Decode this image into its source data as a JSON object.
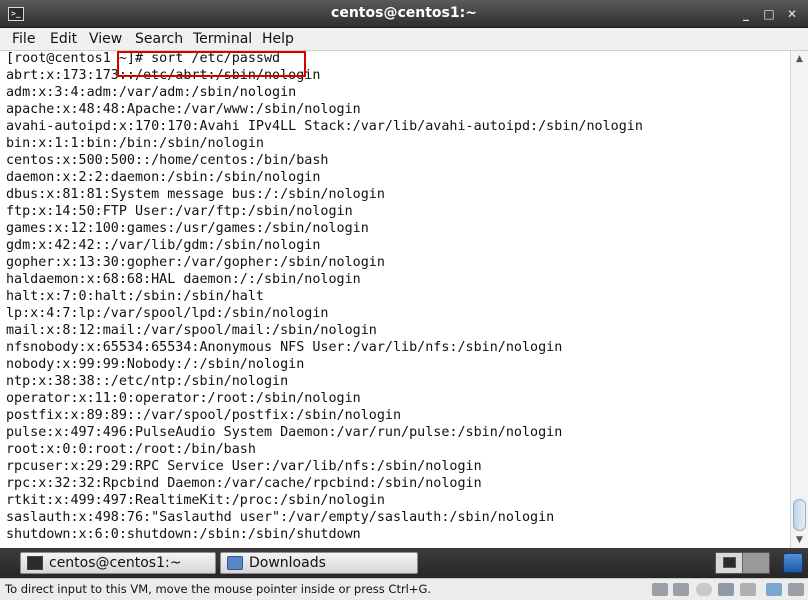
{
  "window": {
    "title": "centos@centos1:~"
  },
  "menu": [
    "File",
    "Edit",
    "View",
    "Search",
    "Terminal",
    "Help"
  ],
  "terminal": {
    "prompt": "[root@centos1 ~]# sort /etc/passwd",
    "lines": [
      "abrt:x:173:173::/etc/abrt:/sbin/nologin",
      "adm:x:3:4:adm:/var/adm:/sbin/nologin",
      "apache:x:48:48:Apache:/var/www:/sbin/nologin",
      "avahi-autoipd:x:170:170:Avahi IPv4LL Stack:/var/lib/avahi-autoipd:/sbin/nologin",
      "bin:x:1:1:bin:/bin:/sbin/nologin",
      "centos:x:500:500::/home/centos:/bin/bash",
      "daemon:x:2:2:daemon:/sbin:/sbin/nologin",
      "dbus:x:81:81:System message bus:/:/sbin/nologin",
      "ftp:x:14:50:FTP User:/var/ftp:/sbin/nologin",
      "games:x:12:100:games:/usr/games:/sbin/nologin",
      "gdm:x:42:42::/var/lib/gdm:/sbin/nologin",
      "gopher:x:13:30:gopher:/var/gopher:/sbin/nologin",
      "haldaemon:x:68:68:HAL daemon:/:/sbin/nologin",
      "halt:x:7:0:halt:/sbin:/sbin/halt",
      "lp:x:4:7:lp:/var/spool/lpd:/sbin/nologin",
      "mail:x:8:12:mail:/var/spool/mail:/sbin/nologin",
      "nfsnobody:x:65534:65534:Anonymous NFS User:/var/lib/nfs:/sbin/nologin",
      "nobody:x:99:99:Nobody:/:/sbin/nologin",
      "ntp:x:38:38::/etc/ntp:/sbin/nologin",
      "operator:x:11:0:operator:/root:/sbin/nologin",
      "postfix:x:89:89::/var/spool/postfix:/sbin/nologin",
      "pulse:x:497:496:PulseAudio System Daemon:/var/run/pulse:/sbin/nologin",
      "root:x:0:0:root:/root:/bin/bash",
      "rpcuser:x:29:29:RPC Service User:/var/lib/nfs:/sbin/nologin",
      "rpc:x:32:32:Rpcbind Daemon:/var/cache/rpcbind:/sbin/nologin",
      "rtkit:x:499:497:RealtimeKit:/proc:/sbin/nologin",
      "saslauth:x:498:76:\"Saslauthd user\":/var/empty/saslauth:/sbin/nologin",
      "shutdown:x:6:0:shutdown:/sbin:/sbin/shutdown"
    ]
  },
  "taskbar": {
    "terminal_label": "centos@centos1:~",
    "downloads_label": "Downloads"
  },
  "status": {
    "text": "To direct input to this VM, move the mouse pointer inside or press Ctrl+G."
  },
  "colors": {
    "highlight": "#d90000",
    "titlebar": "#3a3a3a"
  }
}
